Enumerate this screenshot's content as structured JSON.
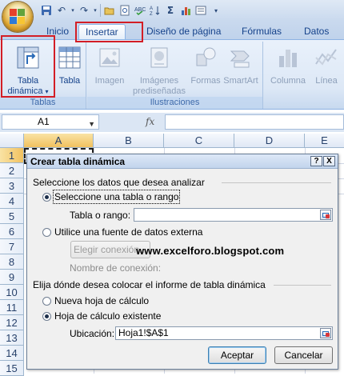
{
  "ribbon_tabs": [
    "Inicio",
    "Insertar",
    "Diseño de página",
    "Fórmulas",
    "Datos"
  ],
  "ribbon": {
    "pivot_table": {
      "line1": "Tabla",
      "line2": "dinámica",
      "dropdown": "▾"
    },
    "table": "Tabla",
    "image": "Imagen",
    "clipart": {
      "line1": "Imágenes",
      "line2": "prediseñadas"
    },
    "shapes": "Formas",
    "smartart": "SmartArt",
    "column": "Columna",
    "line": "Línea",
    "group_tables": "Tablas",
    "group_illustrations": "Ilustraciones"
  },
  "formula_bar": {
    "cell_ref": "A1",
    "fx": "fx",
    "content": ""
  },
  "sheet": {
    "columns": [
      "A",
      "B",
      "C",
      "D",
      "E"
    ],
    "rows": [
      "1",
      "2",
      "3",
      "4",
      "5",
      "6",
      "7",
      "8",
      "9",
      "10",
      "11",
      "12",
      "13",
      "14",
      "15"
    ]
  },
  "dialog": {
    "title": "Crear tabla dinámica",
    "help_btn": "?",
    "close_btn": "X",
    "section1": "Seleccione los datos que desea analizar",
    "opt_range": "Seleccione una tabla o rango",
    "range_label": "Tabla o rango:",
    "range_value": "",
    "opt_external": "Utilice una fuente de datos externa",
    "choose_connection": "Elegir conexión...",
    "connection_name_label": "Nombre de conexión:",
    "section2": "Elija dónde desea colocar el informe de tabla dinámica",
    "opt_new_sheet": "Nueva hoja de cálculo",
    "opt_existing_sheet": "Hoja de cálculo existente",
    "location_label": "Ubicación:",
    "location_value": "Hoja1!$A$1",
    "ok": "Aceptar",
    "cancel": "Cancelar",
    "range_selected": true,
    "existing_sheet_selected": true
  },
  "watermark": "www.excelforo.blogspot.com",
  "colors": {
    "highlight_box": "#d31e26",
    "ribbon_text": "#15428b"
  }
}
